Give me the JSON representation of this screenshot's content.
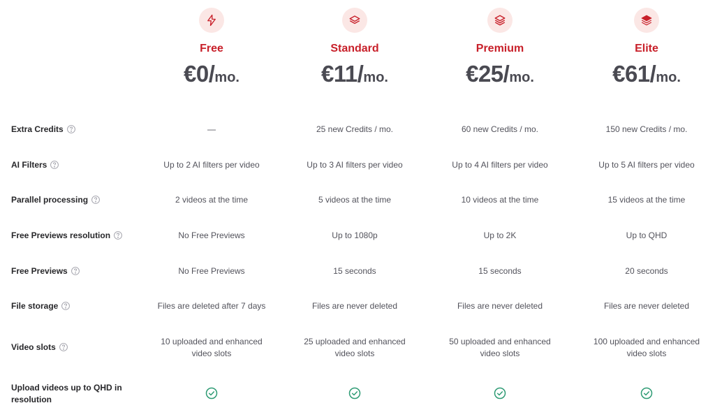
{
  "plans": [
    {
      "name": "Free",
      "price": "€0/",
      "unit": "mo.",
      "icon": "bolt-icon"
    },
    {
      "name": "Standard",
      "price": "€11/",
      "unit": "mo.",
      "icon": "layers-1-icon"
    },
    {
      "name": "Premium",
      "price": "€25/",
      "unit": "mo.",
      "icon": "layers-2-icon"
    },
    {
      "name": "Elite",
      "price": "€61/",
      "unit": "mo.",
      "icon": "layers-3-icon"
    }
  ],
  "features": [
    {
      "label": "Extra Credits",
      "values": [
        "—",
        "25 new Credits / mo.",
        "60 new Credits / mo.",
        "150 new Credits / mo."
      ]
    },
    {
      "label": "AI Filters",
      "values": [
        "Up to 2 AI filters per video",
        "Up to 3 AI filters per video",
        "Up to 4 AI filters per video",
        "Up to 5 AI filters per video"
      ]
    },
    {
      "label": "Parallel processing",
      "values": [
        "2 videos at the time",
        "5 videos at the time",
        "10 videos at the time",
        "15 videos at the time"
      ]
    },
    {
      "label": "Free Previews resolution",
      "values": [
        "No Free Previews",
        "Up to 1080p",
        "Up to 2K",
        "Up to QHD"
      ]
    },
    {
      "label": "Free Previews",
      "values": [
        "No Free Previews",
        "15 seconds",
        "15 seconds",
        "20 seconds"
      ]
    },
    {
      "label": "File storage",
      "values": [
        "Files are deleted after 7 days",
        "Files are never deleted",
        "Files are never deleted",
        "Files are never deleted"
      ]
    },
    {
      "label": "Video slots",
      "values": [
        "10 uploaded and enhanced video slots",
        "25 uploaded and enhanced video slots",
        "50 uploaded and enhanced video slots",
        "100 uploaded and enhanced video slots"
      ]
    },
    {
      "label": "Upload videos up to QHD in resolution",
      "values": [
        "check",
        "check",
        "check",
        "check"
      ]
    }
  ],
  "colors": {
    "accent": "#c8202a",
    "icon_bg": "#fbe7e5",
    "check": "#2e9b74"
  }
}
